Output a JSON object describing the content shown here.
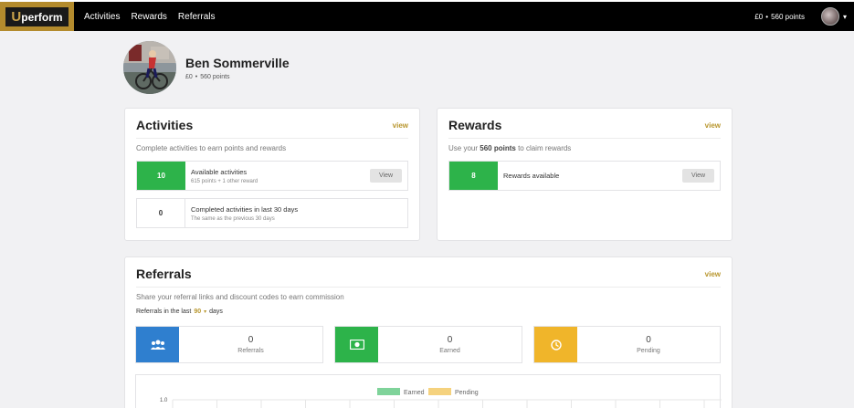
{
  "nav": {
    "logo": {
      "u": "U",
      "rest": "perform"
    },
    "links": [
      "Activities",
      "Rewards",
      "Referrals"
    ],
    "balance_money": "£0",
    "balance_sep": "•",
    "balance_points": "560 points",
    "caret": "▾"
  },
  "profile": {
    "name": "Ben Sommerville",
    "money": "£0",
    "sep": "•",
    "points": "560 points"
  },
  "activities": {
    "title": "Activities",
    "view": "view",
    "desc": "Complete activities to earn points and rewards",
    "rows": [
      {
        "count": "10",
        "label": "Available activities",
        "sub": "615 points + 1 other reward",
        "button": "View"
      },
      {
        "count": "0",
        "label": "Completed activities in last 30 days",
        "sub": "The same as the previous 30 days"
      }
    ]
  },
  "rewards": {
    "title": "Rewards",
    "view": "view",
    "desc_pre": "Use your",
    "desc_bold": "560 points",
    "desc_post": "to claim rewards",
    "row": {
      "count": "8",
      "label": "Rewards available",
      "button": "View"
    }
  },
  "referrals": {
    "title": "Referrals",
    "view": "view",
    "desc": "Share your referral links and discount codes to earn commission",
    "period_pre": "Referrals in the last",
    "period_value": "90",
    "period_caret": "▾",
    "period_post": "days",
    "stats": [
      {
        "value": "0",
        "label": "Referrals",
        "icon": "people-icon",
        "color": "#2f7fcf"
      },
      {
        "value": "0",
        "label": "Earned",
        "icon": "money-icon",
        "color": "#2db34a"
      },
      {
        "value": "0",
        "label": "Pending",
        "icon": "clock-icon",
        "color": "#f0b52a"
      }
    ]
  },
  "chart_data": {
    "type": "bar",
    "series": [
      {
        "name": "Earned",
        "color": "#7fd39a",
        "values": []
      },
      {
        "name": "Pending",
        "color": "#f5d27e",
        "values": []
      }
    ],
    "y_tick_top": "1.0",
    "legend": "top-center",
    "grid": true
  }
}
